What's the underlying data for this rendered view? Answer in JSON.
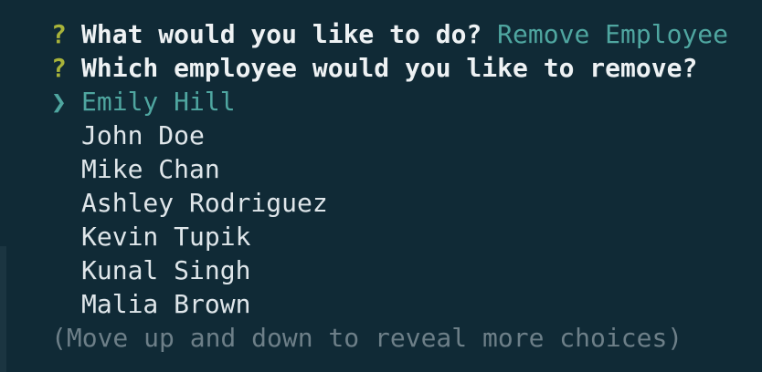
{
  "questions": [
    {
      "mark": "?",
      "prompt": "What would you like to do?",
      "answer": "Remove Employee"
    },
    {
      "mark": "?",
      "prompt": "Which employee would you like to remove?"
    }
  ],
  "list": {
    "pointer": "❯",
    "selected": "Emily Hill",
    "choices": [
      "John Doe",
      "Mike Chan",
      "Ashley Rodriguez",
      "Kevin Tupik",
      "Kunal Singh",
      "Malia Brown"
    ],
    "hint": "(Move up and down to reveal more choices)"
  },
  "colors": {
    "background": "#102a36",
    "question_mark": "#a8b33a",
    "accent": "#4fa6a0",
    "text": "#dfe6ea",
    "hint": "#6d7f88"
  }
}
